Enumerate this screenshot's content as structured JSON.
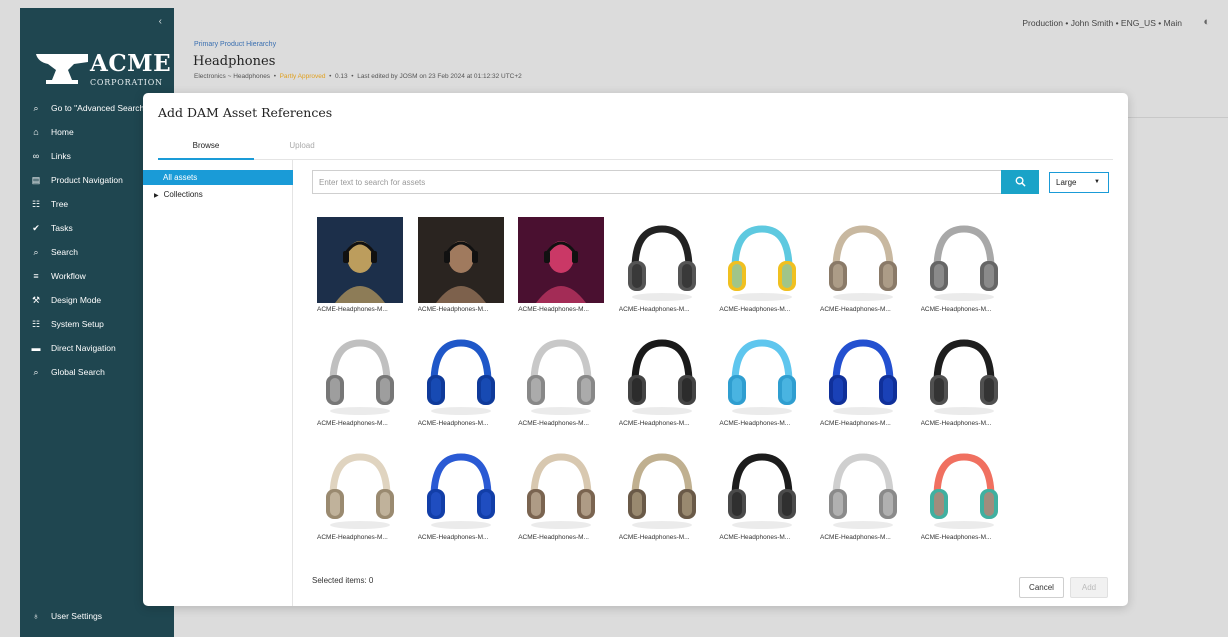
{
  "sidebar": {
    "collapse_icon": "chevron-left-icon",
    "logo": {
      "name": "ACME",
      "subtitle": "CORPORATION"
    },
    "items": [
      {
        "label": "Go to \"Advanced Search\"",
        "icon": "search-icon"
      },
      {
        "label": "Home",
        "icon": "home-icon"
      },
      {
        "label": "Links",
        "icon": "link-icon"
      },
      {
        "label": "Product Navigation",
        "icon": "clipboard-icon"
      },
      {
        "label": "Tree",
        "icon": "tree-icon"
      },
      {
        "label": "Tasks",
        "icon": "check-circle-icon"
      },
      {
        "label": "Search",
        "icon": "search-icon"
      },
      {
        "label": "Workflow",
        "icon": "workflow-icon"
      },
      {
        "label": "Design Mode",
        "icon": "wrench-icon"
      },
      {
        "label": "System Setup",
        "icon": "tree-icon"
      },
      {
        "label": "Direct Navigation",
        "icon": "folder-icon"
      },
      {
        "label": "Global Search",
        "icon": "search-icon"
      }
    ],
    "bottom_items": [
      {
        "label": "User Settings",
        "icon": "user-icon"
      }
    ]
  },
  "header": {
    "hierarchy": "Primary Product Hierarchy",
    "title": "Headphones",
    "breadcrumb": "Electronics ~ Headphones",
    "status": "Partly Approved",
    "version": "0.13",
    "edited": "Last edited by JOSM on 23 Feb 2024 at 01:12:32 UTC+2",
    "separator": "•",
    "context": "Production • John Smith • ENG_US • Main"
  },
  "modal": {
    "title": "Add DAM Asset References",
    "tabs": [
      "Browse",
      "Upload"
    ],
    "tree": {
      "active": "All assets",
      "collections": "Collections"
    },
    "search": {
      "placeholder": "Enter text to search for assets",
      "value": ""
    },
    "size_select": "Large",
    "assets": [
      {
        "label": "ACME-Headphones-M...",
        "kind": "photo",
        "colors": [
          "#1c2f4a",
          "#d8b060"
        ]
      },
      {
        "label": "ACME-Headphones-M...",
        "kind": "photo",
        "colors": [
          "#2a2420",
          "#b58a6a"
        ]
      },
      {
        "label": "ACME-Headphones-M...",
        "kind": "photo",
        "colors": [
          "#4a1030",
          "#e04070"
        ]
      },
      {
        "label": "ACME-Headphones-M...",
        "kind": "headphones",
        "colors": [
          "#222222",
          "#555555"
        ]
      },
      {
        "label": "ACME-Headphones-M...",
        "kind": "headphones",
        "colors": [
          "#5ec9e0",
          "#f0c020"
        ]
      },
      {
        "label": "ACME-Headphones-M...",
        "kind": "headphones",
        "colors": [
          "#c8b8a0",
          "#8a7a68"
        ]
      },
      {
        "label": "ACME-Headphones-M...",
        "kind": "headphones",
        "colors": [
          "#a8a8a8",
          "#666666"
        ]
      },
      {
        "label": "ACME-Headphones-M...",
        "kind": "headphones",
        "colors": [
          "#c0c0c0",
          "#777777"
        ]
      },
      {
        "label": "ACME-Headphones-M...",
        "kind": "headphones",
        "colors": [
          "#1f57c8",
          "#0f3a9a"
        ]
      },
      {
        "label": "ACME-Headphones-M...",
        "kind": "headphones",
        "colors": [
          "#c8c8c8",
          "#888888"
        ]
      },
      {
        "label": "ACME-Headphones-M...",
        "kind": "headphones",
        "colors": [
          "#1a1a1a",
          "#444444"
        ]
      },
      {
        "label": "ACME-Headphones-M...",
        "kind": "headphones",
        "colors": [
          "#5fc6ee",
          "#2f9ed0"
        ]
      },
      {
        "label": "ACME-Headphones-M...",
        "kind": "headphones",
        "colors": [
          "#2350d0",
          "#10309a"
        ]
      },
      {
        "label": "ACME-Headphones-M...",
        "kind": "headphones",
        "colors": [
          "#1e1e1e",
          "#505050"
        ]
      },
      {
        "label": "ACME-Headphones-M...",
        "kind": "headphones",
        "colors": [
          "#e0d4c0",
          "#9a8a70"
        ]
      },
      {
        "label": "ACME-Headphones-M...",
        "kind": "headphones",
        "colors": [
          "#2a5ad4",
          "#123ea8"
        ]
      },
      {
        "label": "ACME-Headphones-M...",
        "kind": "headphones",
        "colors": [
          "#d8c8b0",
          "#7a6450"
        ]
      },
      {
        "label": "ACME-Headphones-M...",
        "kind": "headphones",
        "colors": [
          "#c0b090",
          "#6a5a48"
        ]
      },
      {
        "label": "ACME-Headphones-M...",
        "kind": "headphones",
        "colors": [
          "#1c1c1c",
          "#4a4a4a"
        ]
      },
      {
        "label": "ACME-Headphones-M...",
        "kind": "headphones",
        "colors": [
          "#cfcfcf",
          "#8a8a8a"
        ]
      },
      {
        "label": "ACME-Headphones-M...",
        "kind": "headphones",
        "colors": [
          "#f07060",
          "#40b0a0"
        ]
      }
    ],
    "selected_label": "Selected items: 0",
    "cancel_label": "Cancel",
    "add_label": "Add"
  },
  "colors": {
    "sidebar": "#1f4650",
    "accent": "#1a9bd7",
    "search_button": "#1aa3c8",
    "status": "#e0a020",
    "link": "#3a6fb0"
  }
}
